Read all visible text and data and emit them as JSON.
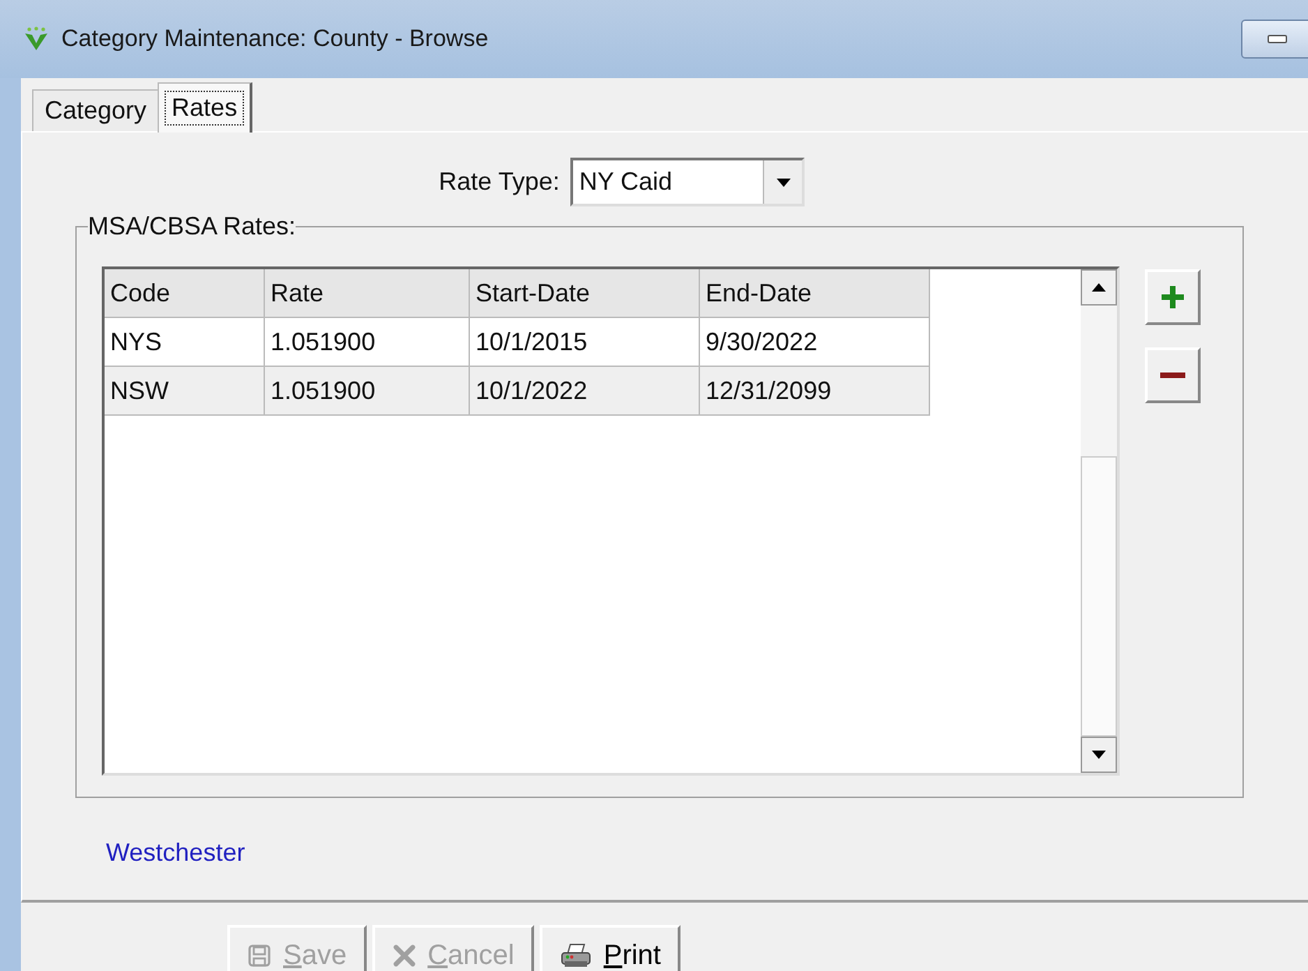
{
  "window": {
    "title": "Category Maintenance: County - Browse"
  },
  "tabs": [
    {
      "label": "Category",
      "selected": false
    },
    {
      "label": "Rates",
      "selected": true
    }
  ],
  "rate_type": {
    "label": "Rate Type:",
    "value": "NY Caid"
  },
  "rates_group": {
    "title": "MSA/CBSA Rates:",
    "columns": [
      "Code",
      "Rate",
      "Start-Date",
      "End-Date"
    ],
    "rows": [
      [
        "NYS",
        "1.051900",
        "10/1/2015",
        "9/30/2022"
      ],
      [
        "NSW",
        "1.051900",
        "10/1/2022",
        "12/31/2099"
      ]
    ]
  },
  "county_name": "Westchester",
  "buttons": [
    {
      "label": "Save",
      "kind": "save",
      "disabled": true
    },
    {
      "label": "Cancel",
      "kind": "cancel",
      "disabled": true
    },
    {
      "label": "Print",
      "kind": "print",
      "disabled": false
    }
  ]
}
